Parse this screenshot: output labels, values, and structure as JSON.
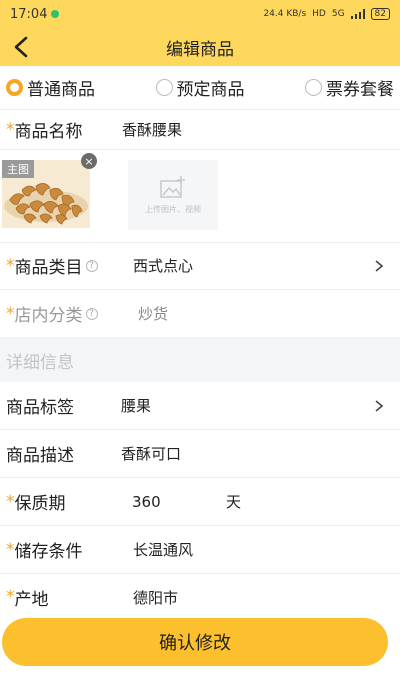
{
  "status": {
    "time": "17:04",
    "net_speed": "24.4 KB/s",
    "hd": "HD",
    "network": "5G",
    "battery": "82"
  },
  "nav": {
    "title": "编辑商品"
  },
  "types": [
    {
      "label": "普通商品",
      "selected": true
    },
    {
      "label": "预定商品",
      "selected": false
    },
    {
      "label": "票券套餐",
      "selected": false
    }
  ],
  "fields": {
    "name": {
      "label": "商品名称",
      "required": "*",
      "value": "香酥腰果"
    },
    "media": {
      "main_badge": "主图",
      "upload_text": "上传图片、视频"
    },
    "category": {
      "label": "商品类目",
      "required": "*",
      "value": "西式点心"
    },
    "store_category": {
      "label": "店内分类",
      "required": "*",
      "value": "炒货"
    },
    "section_detail": "详细信息",
    "tags": {
      "label": "商品标签",
      "value": "腰果"
    },
    "description": {
      "label": "商品描述",
      "value": "香酥可口"
    },
    "shelf_life": {
      "label": "保质期",
      "required": "*",
      "value": "360",
      "unit": "天"
    },
    "storage": {
      "label": "储存条件",
      "required": "*",
      "value": "长温通风"
    },
    "origin": {
      "label": "产地",
      "required": "*",
      "value": "德阳市"
    }
  },
  "confirm_label": "确认修改",
  "colors": {
    "accent": "#fdd85c",
    "button": "#fcc02e",
    "required": "#f5a623"
  }
}
